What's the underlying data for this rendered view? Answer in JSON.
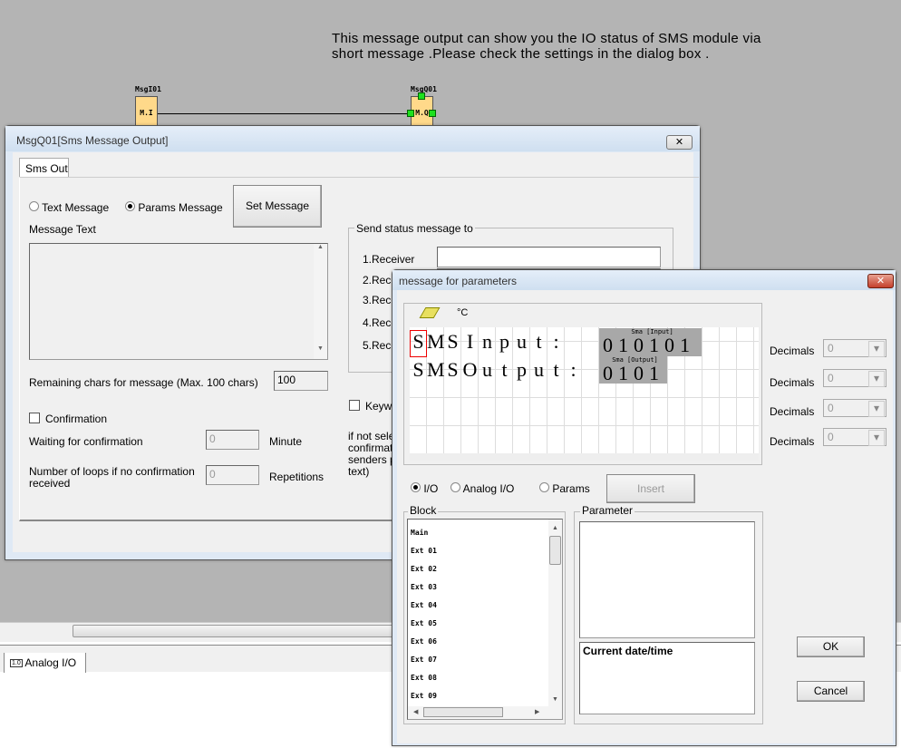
{
  "canvas": {
    "note_line1": "This message output can show you the IO status of SMS module via",
    "note_line2": "short message .Please check the settings in the dialog box .",
    "block_in": {
      "name": "MsgI01",
      "label": "M.I"
    },
    "block_out": {
      "name": "MsgQ01",
      "label": "M.Q"
    }
  },
  "dialog1": {
    "title": "MsgQ01[Sms Message Output]",
    "close": "✕",
    "tab": "Sms Out",
    "radio_text": "Text Message",
    "radio_params": "Params Message",
    "selected": "Params Message",
    "set_message": "Set Message",
    "message_text_label": "Message Text",
    "send_group": "Send status message to",
    "receivers": [
      "1.Receiver",
      "2.Rece",
      "3.Rece",
      "4.Rece",
      "5.Rece"
    ],
    "remaining_label": "Remaining chars for message (Max. 100 chars)",
    "remaining_value": "100",
    "keyword": "Keywo",
    "confirmation": "Confirmation",
    "waiting_label": "Waiting for confirmation",
    "waiting_value": "0",
    "waiting_unit": "Minute",
    "loops_label1": "Number of loops if no confirmation",
    "loops_label2": "received",
    "loops_value": "0",
    "loops_unit": "Repetitions",
    "note_lines": [
      "if not selec",
      "confirmatio",
      "senders ph",
      "text)"
    ]
  },
  "dialog2": {
    "title": "message for parameters",
    "close": "✕",
    "toolbar": {
      "eraser": "eraser-icon",
      "degree": "°C"
    },
    "line1": [
      "S",
      "M",
      "S",
      "I",
      "n",
      "p",
      "u",
      "t",
      ":"
    ],
    "line2": [
      "S",
      "M",
      "S",
      "O",
      "u",
      "t",
      "p",
      "u",
      "t",
      ":"
    ],
    "io_input": {
      "label": "Sma [Input]",
      "value": "010101"
    },
    "io_output": {
      "label": "Sma [Output]",
      "value": "0101"
    },
    "decimals_label": "Decimals",
    "decimals": [
      "0",
      "0",
      "0",
      "0"
    ],
    "radio_io": "I/O",
    "radio_analog": "Analog I/O",
    "radio_params": "Params",
    "selected": "I/O",
    "insert": "Insert",
    "block_group": "Block",
    "block_items": [
      "Main",
      "Ext 01",
      "Ext 02",
      "Ext 03",
      "Ext 04",
      "Ext 05",
      "Ext 06",
      "Ext 07",
      "Ext 08",
      "Ext 09"
    ],
    "parameter_group": "Parameter",
    "param_item": "Current date/time",
    "ok": "OK",
    "cancel": "Cancel"
  },
  "bottom": {
    "tab": "Analog I/O",
    "tab_icon": "1.0"
  }
}
